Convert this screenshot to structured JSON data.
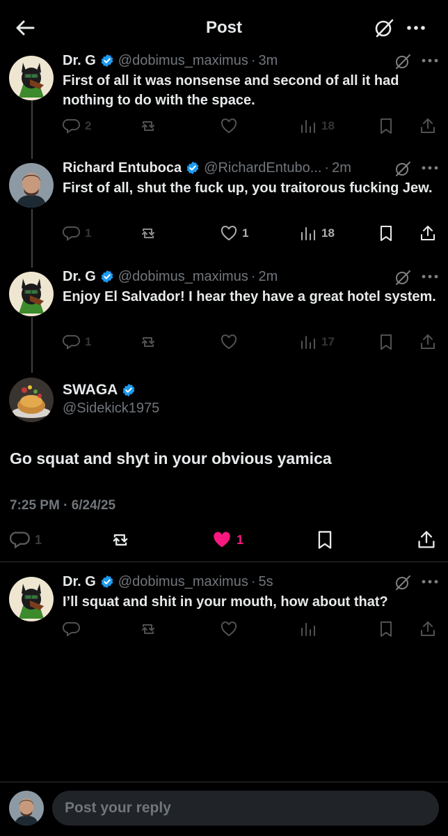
{
  "header": {
    "title": "Post"
  },
  "replies_above": [
    {
      "name": "Dr. G",
      "handle": "@dobimus_maximus",
      "time": "3m",
      "text": "First of all it was nonsense and second of all it had nothing to do with the space.",
      "replies": "2",
      "reposts": "",
      "likes": "",
      "views": "18"
    },
    {
      "name": "Richard Entuboca",
      "handle": "@RichardEntubo...",
      "time": "2m",
      "text": "First of all, shut the fuck up, you traitorous fucking Jew.",
      "replies": "1",
      "reposts": "",
      "likes": "1",
      "views": "18"
    },
    {
      "name": "Dr. G",
      "handle": "@dobimus_maximus",
      "time": "2m",
      "text": "Enjoy El Salvador!  I hear they have a great hotel system.",
      "replies": "1",
      "reposts": "",
      "likes": "",
      "views": "17"
    }
  ],
  "main_post": {
    "name": "SWAGA",
    "handle": "@Sidekick1975",
    "text": "Go squat and shyt in your obvious yamica",
    "timestamp": "7:25 PM · 6/24/25",
    "replies": "1",
    "likes": "1",
    "like_color": "#f91880"
  },
  "reply_below": {
    "name": "Dr. G",
    "handle": "@dobimus_maximus",
    "time": "5s",
    "text": "I’ll squat and shit in your mouth, how about that?"
  },
  "composer": {
    "placeholder": "Post your reply"
  },
  "colors": {
    "verified": "#1d9bf0",
    "background": "#000000",
    "muted": "#71767b"
  }
}
